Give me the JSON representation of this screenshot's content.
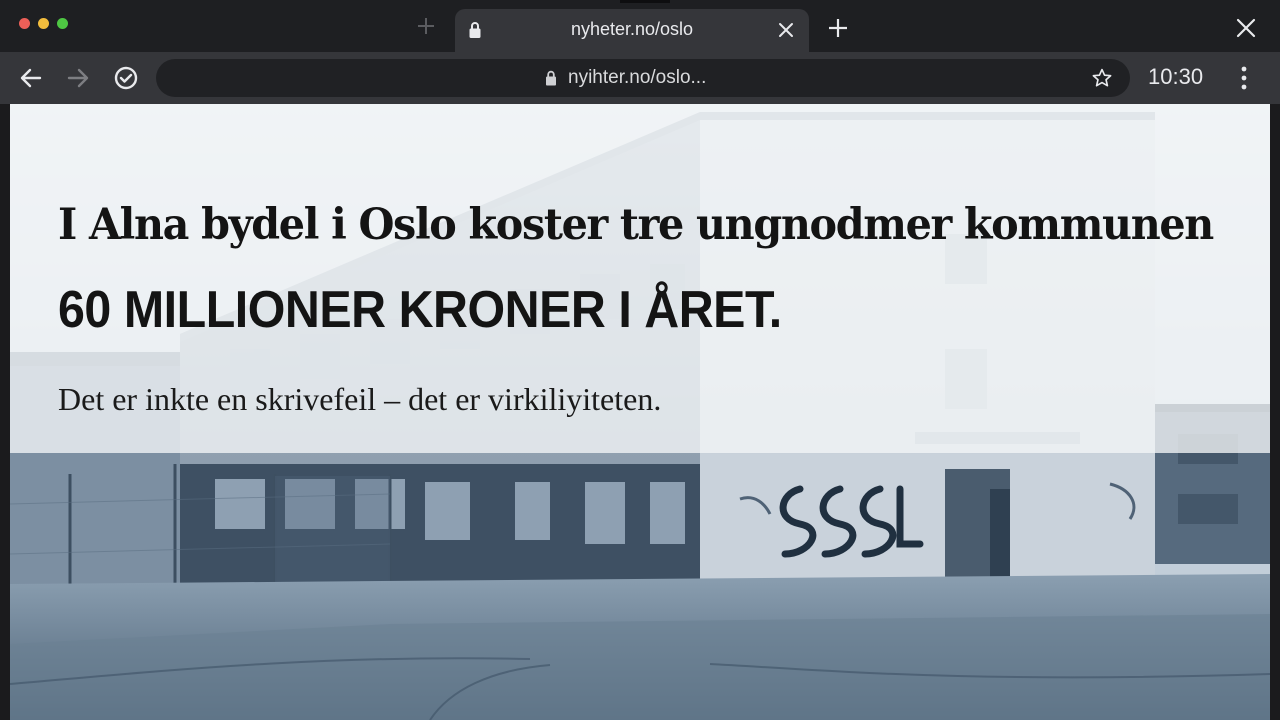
{
  "browser": {
    "tab": {
      "title": "nyheter.no/oslo"
    },
    "omnibox": {
      "url": "nyihter.no/oslo..."
    },
    "clock": "10:30"
  },
  "icons": {
    "window_controls": [
      "close-dot",
      "minimize-dot",
      "maximize-dot"
    ],
    "tab": [
      "lock-icon",
      "close-icon"
    ],
    "toolbar": [
      "back-arrow-icon",
      "forward-arrow-icon",
      "shield-check-icon",
      "lock-icon",
      "star-icon",
      "kebab-menu-icon"
    ],
    "tabstrip": [
      "new-tab-icon",
      "window-close-icon"
    ]
  },
  "colors": {
    "traffic_red": "#ec5f58",
    "traffic_yellow": "#f3bd3d",
    "traffic_green": "#4ec743",
    "chrome_dark": "#1e1f22",
    "chrome_toolbar": "#35363a",
    "omnibox": "#202124"
  },
  "article": {
    "headline": "I Alna bydel i Oslo koster tre ungnodmer kommunen",
    "headline_emphasis": "60 MILLIONER KRONER I ÅRET.",
    "subline": "Det er inkte en skrivefeil – det er virkiliyiteten."
  }
}
